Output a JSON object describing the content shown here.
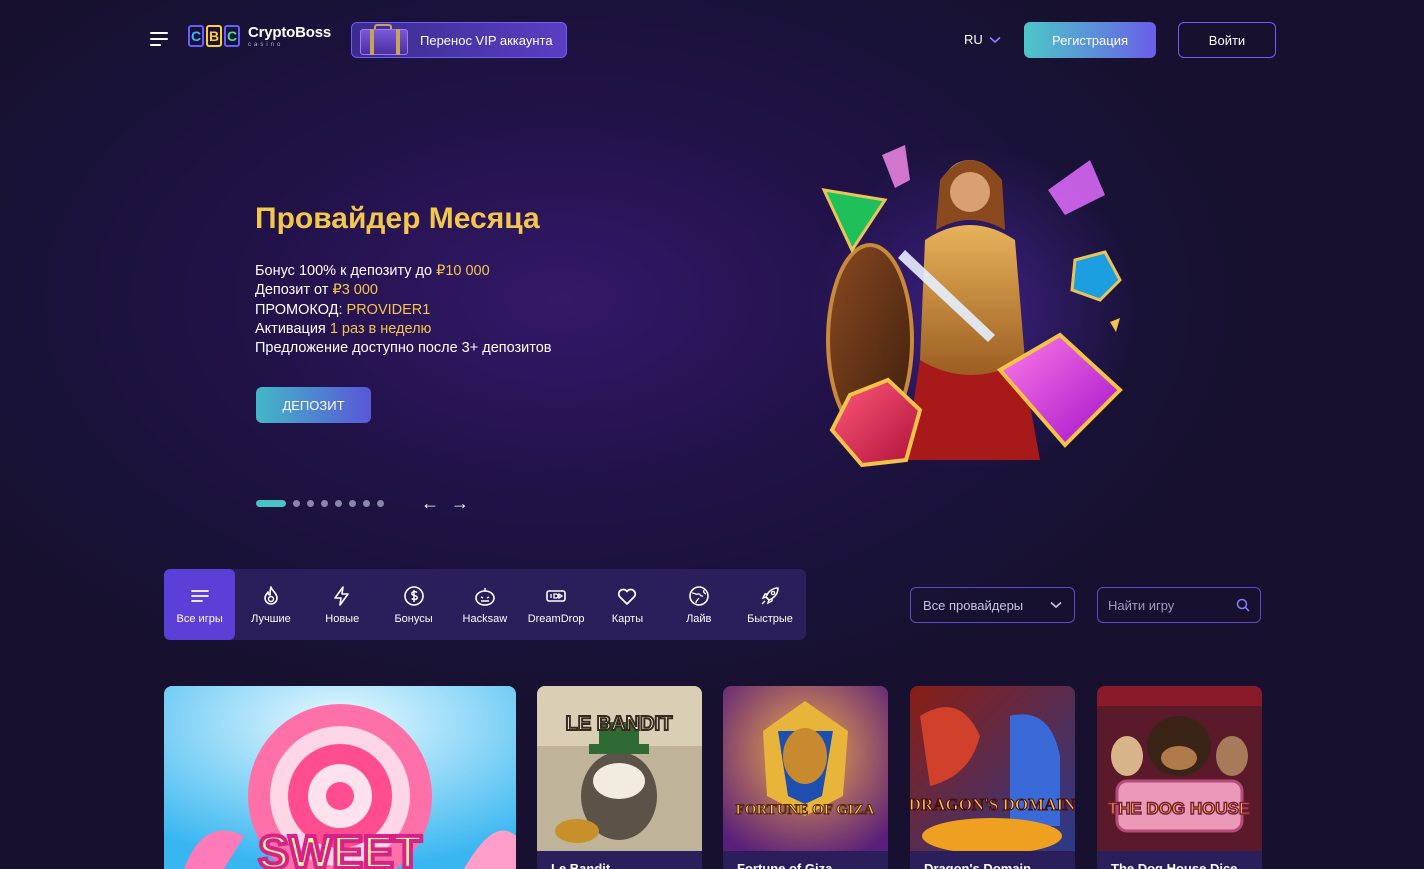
{
  "header": {
    "logo_letters": [
      "C",
      "B",
      "C"
    ],
    "logo_name": "CryptoBoss",
    "logo_sub": "casino",
    "vip_label": "Перенос VIP аккаунта",
    "language": "RU",
    "register_label": "Регистрация",
    "login_label": "Войти"
  },
  "hero": {
    "title": "Провайдер Месяца",
    "line1_prefix": "Бонус 100% к депозиту до ",
    "line1_value": "₽10 000",
    "line2_prefix": "Депозит от ",
    "line2_value": "₽3 000",
    "line3_prefix": "ПРОМОКОД: ",
    "line3_value": "PROVIDER1",
    "line4_prefix": "Активация ",
    "line4_value": "1 раз в неделю",
    "line5": "Предложение доступно после 3+ депозитов",
    "button_label": "ДЕПОЗИТ",
    "slide_count": 8,
    "active_slide": 1,
    "prev_arrow": "←",
    "next_arrow": "→"
  },
  "categories": [
    {
      "label": "Все игры",
      "icon": "list-icon",
      "active": true
    },
    {
      "label": "Лучшие",
      "icon": "fire-icon",
      "active": false
    },
    {
      "label": "Новые",
      "icon": "lightning-icon",
      "active": false
    },
    {
      "label": "Бонусы",
      "icon": "dollar-icon",
      "active": false
    },
    {
      "label": "Hacksaw",
      "icon": "pumpkin-icon",
      "active": false
    },
    {
      "label": "DreamDrop",
      "icon": "dreamdrop-icon",
      "active": false
    },
    {
      "label": "Карты",
      "icon": "heart-icon",
      "active": false
    },
    {
      "label": "Лайв",
      "icon": "globe-icon",
      "active": false
    },
    {
      "label": "Быстрые",
      "icon": "rocket-icon",
      "active": false
    }
  ],
  "filters": {
    "providers_label": "Все провайдеры",
    "search_placeholder": "Найти игру"
  },
  "games": [
    {
      "name": "",
      "art_text": "SWEET"
    },
    {
      "name": "Le Bandit",
      "art_text": "LE BANDIT"
    },
    {
      "name": "Fortune of Giza",
      "art_text": "FORTUNE OF GIZA"
    },
    {
      "name": "Dragon's Domain",
      "art_text": "DRAGON'S DOMAIN"
    },
    {
      "name": "The Dog House Dice",
      "art_text": "THE DOG HOUSE"
    }
  ],
  "colors": {
    "accent_gold": "#f3c64c",
    "accent_teal": "#46c4c6",
    "accent_purple": "#5b3fd6",
    "background": "#1b1340"
  }
}
